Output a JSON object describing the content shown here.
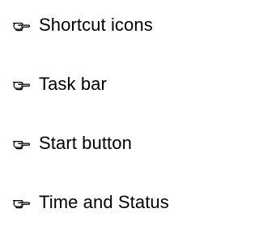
{
  "bullet_icon": "pointing-hand-icon",
  "items": [
    {
      "label": "Shortcut icons"
    },
    {
      "label": "Task bar"
    },
    {
      "label": "Start button"
    },
    {
      "label": "Time and Status"
    }
  ]
}
